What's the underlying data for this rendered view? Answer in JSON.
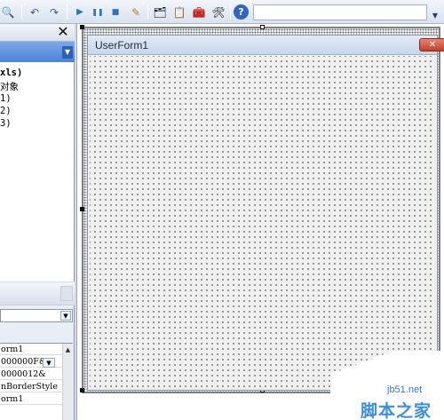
{
  "toolbar": {
    "buttons": [
      {
        "icon": "find-icon",
        "glyph": "🔍"
      },
      {
        "icon": "undo-icon",
        "glyph": "↶"
      },
      {
        "icon": "redo-icon",
        "glyph": "↷"
      },
      {
        "icon": "run-icon",
        "glyph": "▶"
      },
      {
        "icon": "break-icon",
        "glyph": "❚❚"
      },
      {
        "icon": "reset-icon",
        "glyph": "■"
      },
      {
        "icon": "design-mode-icon",
        "glyph": "✎"
      },
      {
        "icon": "project-explorer-icon",
        "glyph": "🗂"
      },
      {
        "icon": "properties-icon",
        "glyph": "📋"
      },
      {
        "icon": "object-browser-icon",
        "glyph": "🧰"
      },
      {
        "icon": "toolbox-icon",
        "glyph": "🛠"
      },
      {
        "icon": "help-icon",
        "glyph": "?"
      }
    ],
    "search_value": ""
  },
  "project": {
    "close_glyph": "✕",
    "tree": [
      "xls)",
      "对象",
      "1)",
      "2)",
      "3)"
    ]
  },
  "properties": {
    "combo_value": "",
    "rows": [
      "orm1",
      "000000F&",
      "0000012&",
      "nBorderStyle",
      "orm1"
    ]
  },
  "userform": {
    "title": "UserForm1",
    "close_glyph": "✕"
  },
  "watermark": {
    "domain": "jb51.net",
    "brand": "脚本之家"
  },
  "colors": {
    "title_bar": "#c7d6ea",
    "close_button": "#c0412c",
    "explorer_bar": "#4c82d6",
    "watermark": "#3a8ee0"
  }
}
